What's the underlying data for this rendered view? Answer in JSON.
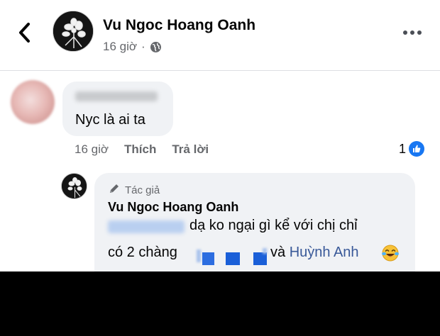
{
  "header": {
    "page_name": "Vu Ngoc Hoang Oanh",
    "time": "16 giờ",
    "separator": "·",
    "icons": {
      "back": "back-arrow-icon",
      "privacy": "globe-icon",
      "more": "more-options-icon"
    }
  },
  "comment": {
    "text": "Nyc là ai ta",
    "time": "16 giờ",
    "like_label": "Thích",
    "reply_label": "Trả lời",
    "reaction_count": "1",
    "reaction_icon": "like-thumb-icon"
  },
  "reply": {
    "author_badge": "Tác giả",
    "author_name": "Vu Ngoc Hoang Oanh",
    "text_line1": "dạ ko ngại gì kể với chị chỉ",
    "text_line2": "có 2 chàng",
    "text_line3_prefix": "và ",
    "mention": "Huỳnh Anh",
    "emoji_icon": "laughing-tears-emoji-icon"
  },
  "colors": {
    "accent": "#1877f2",
    "mention": "#385898",
    "bubble": "#f0f2f5",
    "muted_text": "#65676b"
  }
}
